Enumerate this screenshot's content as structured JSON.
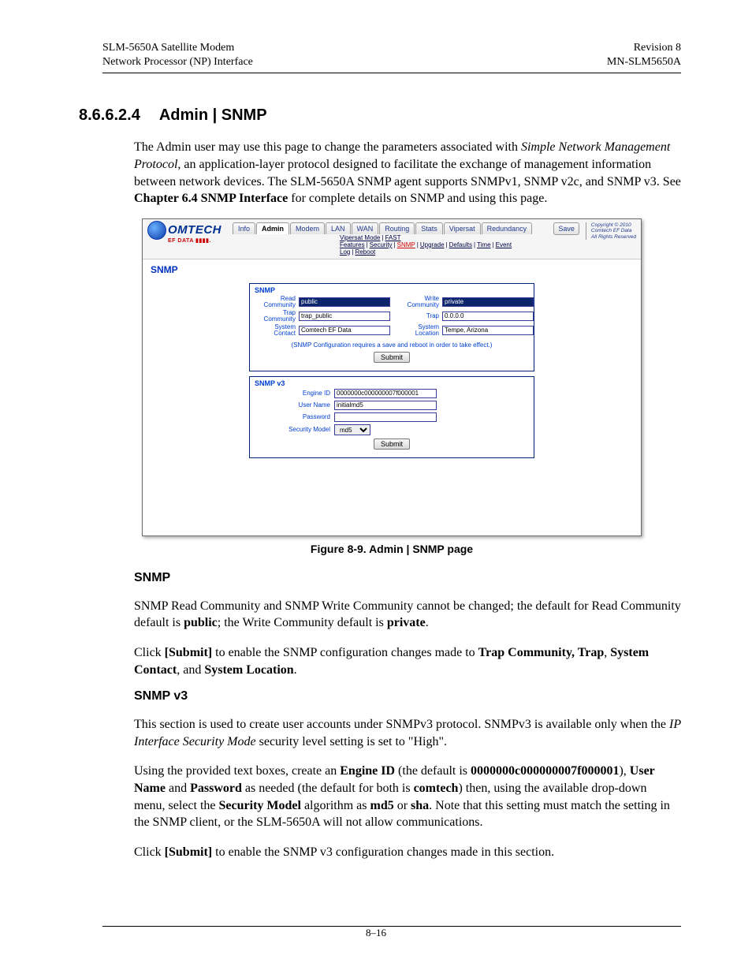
{
  "header": {
    "left1": "SLM-5650A Satellite Modem",
    "left2": "Network Processor (NP) Interface",
    "right1": "Revision 8",
    "right2": "MN-SLM5650A"
  },
  "section": {
    "num": "8.6.6.2.4",
    "title": "Admin | SNMP"
  },
  "para_intro_1": "The Admin user may use this page to change the parameters associated with ",
  "para_intro_i": "Simple Network Management Protocol",
  "para_intro_2": ", an application-layer protocol designed to facilitate the exchange of management information between network devices. The SLM-5650A SNMP agent supports SNMPv1, SNMP v2c, and SNMP v3. See ",
  "para_intro_b": "Chapter 6.4 SNMP Interface",
  "para_intro_3": " for complete details on SNMP and using this page.",
  "webshot": {
    "logo_name": "OMTECH",
    "logo_sub": "EF DATA ▮▮▮▮.",
    "tabs": [
      "Info",
      "Admin",
      "Modem",
      "LAN",
      "WAN",
      "Routing",
      "Stats",
      "Vipersat",
      "Redundancy"
    ],
    "active_tab": "Admin",
    "save": "Save",
    "copy1": "Copyright © 2010",
    "copy2": "Comtech EF Data",
    "copy3": "All Rights Reserved",
    "subnav": [
      "Vipersat Mode",
      "FAST Features",
      "Security",
      "SNMP",
      "Upgrade",
      "Defaults",
      "Time",
      "Event Log",
      "Reboot"
    ],
    "subnav_current": "SNMP",
    "page_title": "SNMP",
    "box1": {
      "title": "SNMP",
      "read_label": "Read Community",
      "read_value": "public",
      "write_label": "Write Community",
      "write_value": "private",
      "trapc_label": "Trap Community",
      "trapc_value": "trap_public",
      "trap_label": "Trap",
      "trap_value": "0.0.0.0",
      "contact_label": "System Contact",
      "contact_value": "Comtech EF Data",
      "location_label": "System Location",
      "location_value": "Tempe, Arizona",
      "note": "(SNMP Configuration requires a save and reboot in order to take effect.)",
      "submit": "Submit"
    },
    "box2": {
      "title": "SNMP v3",
      "engine_label": "Engine ID",
      "engine_value": "0000000c000000007f000001",
      "user_label": "User Name",
      "user_value": "initialmd5",
      "pass_label": "Password",
      "pass_value": "",
      "sec_label": "Security Model",
      "sec_value": "md5",
      "submit": "Submit"
    }
  },
  "fig_caption": "Figure 8-9. Admin | SNMP page",
  "snmp_h": "SNMP",
  "snmp_p1a": "SNMP Read Community and SNMP Write Community cannot be changed; the default for Read Community default is ",
  "snmp_p1b": "public",
  "snmp_p1c": "; the Write Community default is ",
  "snmp_p1d": "private",
  "snmp_p1e": ".",
  "snmp_p2a": "Click ",
  "snmp_p2b": "[Submit]",
  "snmp_p2c": " to enable the SNMP configuration changes made to ",
  "snmp_p2d": "Trap Community, Trap",
  "snmp_p2e": ", ",
  "snmp_p2f": "System Contact",
  "snmp_p2g": ", and ",
  "snmp_p2h": "System Location",
  "snmp_p2i": ".",
  "snmpv3_h": "SNMP v3",
  "v3_p1a": "This section is used to create user accounts under SNMPv3 protocol. SNMPv3 is available only when the ",
  "v3_p1b": "IP Interface Security Mode",
  "v3_p1c": " security level setting is set to \"High\".",
  "v3_p2a": "Using the provided text boxes, create an ",
  "v3_p2b": "Engine ID",
  "v3_p2c": " (the default is ",
  "v3_p2d": "0000000c000000007f000001",
  "v3_p2e": "), ",
  "v3_p2f": "User Name",
  "v3_p2g": " and ",
  "v3_p2h": "Password",
  "v3_p2i": " as needed (the default for both is ",
  "v3_p2j": "comtech",
  "v3_p2k": ") then, using the available drop-down menu, select the ",
  "v3_p2l": "Security Model",
  "v3_p2m": " algorithm as ",
  "v3_p2n": "md5",
  "v3_p2o": " or ",
  "v3_p2p": "sha",
  "v3_p2q": ". Note that this setting must match the setting in the SNMP client, or the SLM-5650A will not allow communications.",
  "v3_p3a": "Click ",
  "v3_p3b": "[Submit]",
  "v3_p3c": " to enable the SNMP v3 configuration changes made in this section.",
  "footer_page": "8–16"
}
